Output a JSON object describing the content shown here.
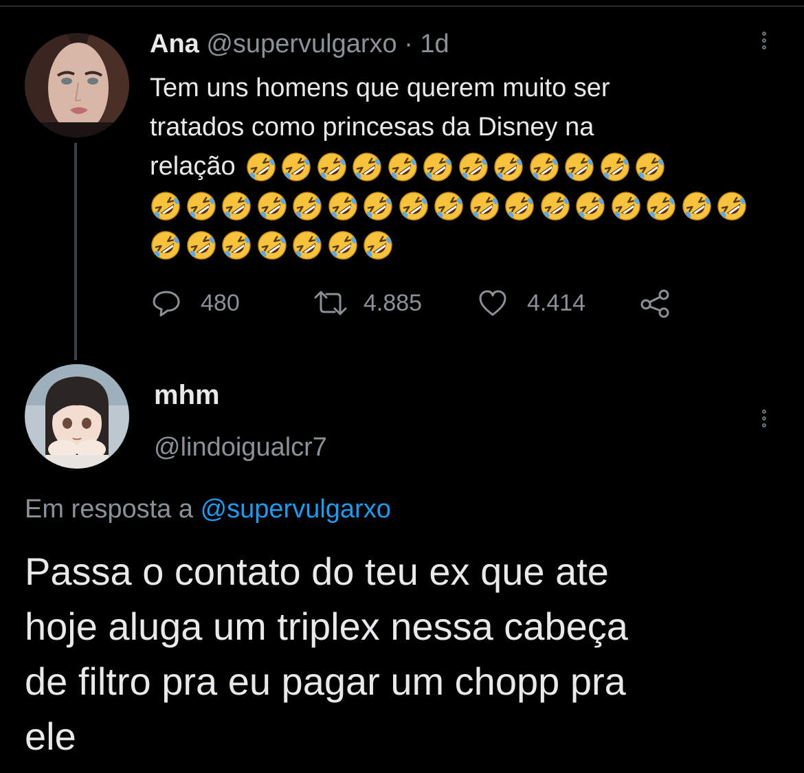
{
  "tweet1": {
    "author_name": "Ana",
    "handle": "@supervulgarxo",
    "separator": "·",
    "time": "1d",
    "text_lines": [
      "Tem uns homens que querem muito ser",
      "tratados como princesas da Disney  na",
      "relação"
    ],
    "emoji": "🤣",
    "emoji_rows": [
      12,
      17,
      7
    ],
    "emoji_icon": "rolling-on-floor-laughing-emoji",
    "stats": {
      "replies": "480",
      "retweets": "4.885",
      "likes": "4.414"
    }
  },
  "tweet2": {
    "author_name": "mhm",
    "handle": "@lindoigualcr7",
    "reply_prefix": "Em resposta a",
    "reply_mention": "@supervulgarxo",
    "text": "Passa o contato do teu ex que ate hoje aluga um triplex nessa cabeça de filtro pra eu pagar um chopp pra ele",
    "text_lines": [
      "Passa o contato do teu ex que ate",
      "hoje aluga um triplex nessa cabeça",
      "de filtro pra eu pagar um chopp pra",
      "ele"
    ]
  },
  "colors": {
    "background": "#000000",
    "text": "#e7e9ea",
    "secondary_text": "#8b9196",
    "link": "#1d9bf0",
    "emoji_face": "#f7c33d"
  }
}
